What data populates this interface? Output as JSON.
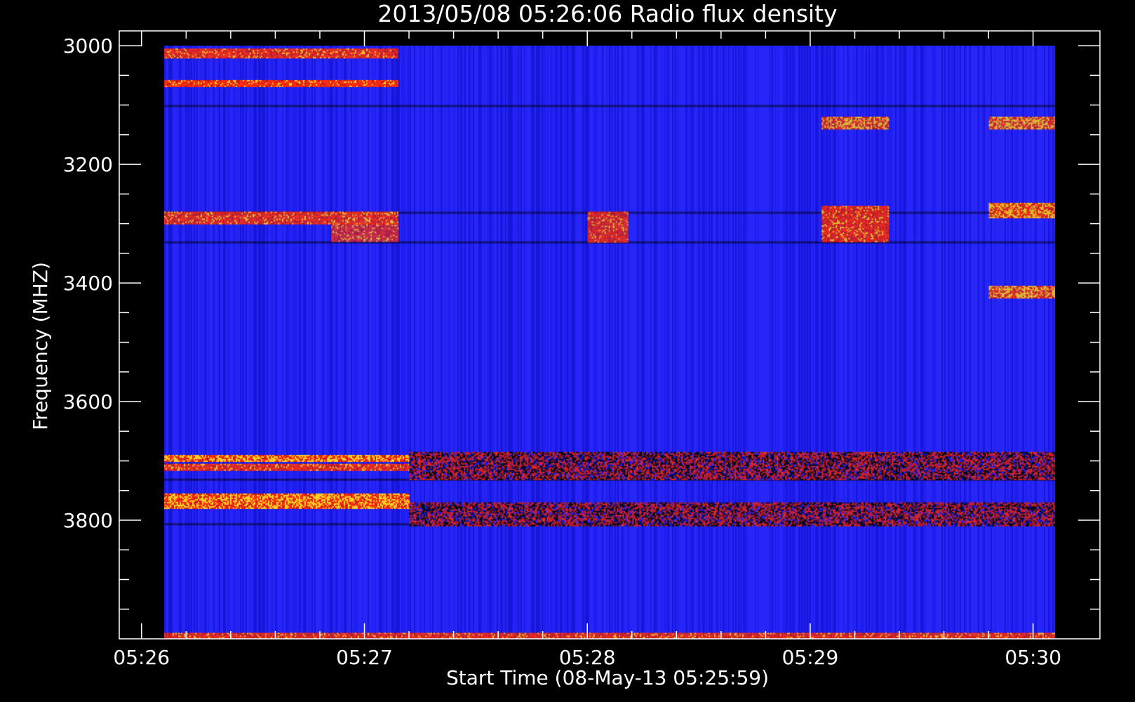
{
  "chart_data": {
    "type": "heatmap",
    "title": "2013/05/08 05:26:06 Radio flux density",
    "xlabel": "Start Time (08-May-13 05:25:59)",
    "ylabel": "Frequency (MHZ)",
    "x_ticks": [
      "05:26",
      "05:27",
      "05:28",
      "05:29",
      "05:30"
    ],
    "y_ticks": [
      "3000",
      "3200",
      "3400",
      "3600",
      "3800"
    ],
    "x_range_minutes": [
      -0.1,
      4.3
    ],
    "y_range_mhz": [
      2975,
      4000
    ],
    "data_extent": {
      "time_minutes_start": 0.1,
      "time_minutes_end": 4.1,
      "freq_mhz_start": 3000,
      "freq_mhz_end": 4000
    },
    "y_inverted": true,
    "colormap": [
      "#000000",
      "#1010c8",
      "#1e1ef0",
      "#2b2bff",
      "#c81e1e",
      "#ff3010",
      "#ffd020",
      "#ffffff"
    ],
    "background_color": "#1e1ef0",
    "emission_bands": [
      {
        "freq_mhz": [
          3005,
          3020
        ],
        "time_minutes": [
          0.1,
          1.15
        ],
        "level": "hot"
      },
      {
        "freq_mhz": [
          3058,
          3068
        ],
        "time_minutes": [
          0.1,
          1.15
        ],
        "level": "hot"
      },
      {
        "freq_mhz": [
          3280,
          3300
        ],
        "time_minutes": [
          0.1,
          1.15
        ],
        "level": "hot"
      },
      {
        "freq_mhz": [
          3300,
          3330
        ],
        "time_minutes": [
          0.85,
          1.15
        ],
        "level": "hot"
      },
      {
        "freq_mhz": [
          3280,
          3330
        ],
        "time_minutes": [
          2.0,
          2.18
        ],
        "level": "hot"
      },
      {
        "freq_mhz": [
          3690,
          3700
        ],
        "time_minutes": [
          0.1,
          1.2
        ],
        "level": "bright"
      },
      {
        "freq_mhz": [
          3705,
          3715
        ],
        "time_minutes": [
          0.1,
          1.2
        ],
        "level": "hot"
      },
      {
        "freq_mhz": [
          3755,
          3780
        ],
        "time_minutes": [
          0.1,
          1.2
        ],
        "level": "bright"
      },
      {
        "freq_mhz": [
          3685,
          3730
        ],
        "time_minutes": [
          1.2,
          4.1
        ],
        "level": "mixed"
      },
      {
        "freq_mhz": [
          3770,
          3810
        ],
        "time_minutes": [
          1.2,
          4.1
        ],
        "level": "mixed"
      },
      {
        "freq_mhz": [
          3120,
          3140
        ],
        "time_minutes": [
          3.05,
          3.35
        ],
        "level": "bright"
      },
      {
        "freq_mhz": [
          3270,
          3330
        ],
        "time_minutes": [
          3.05,
          3.35
        ],
        "level": "hot"
      },
      {
        "freq_mhz": [
          3120,
          3140
        ],
        "time_minutes": [
          3.8,
          4.1
        ],
        "level": "bright"
      },
      {
        "freq_mhz": [
          3265,
          3290
        ],
        "time_minutes": [
          3.8,
          4.1
        ],
        "level": "bright"
      },
      {
        "freq_mhz": [
          3405,
          3425
        ],
        "time_minutes": [
          3.8,
          4.1
        ],
        "level": "bright"
      },
      {
        "freq_mhz": [
          3990,
          4000
        ],
        "time_minutes": [
          0.1,
          4.1
        ],
        "level": "hot"
      }
    ]
  }
}
